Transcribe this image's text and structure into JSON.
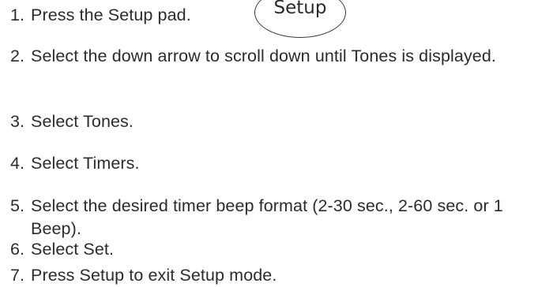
{
  "setup_pad": {
    "label": "Setup"
  },
  "steps": [
    {
      "number": "1.",
      "text": "Press the Setup pad."
    },
    {
      "number": "2.",
      "text": "Select the down arrow to scroll down until Tones is displayed."
    },
    {
      "number": "3.",
      "text": "Select Tones."
    },
    {
      "number": "4.",
      "text": "Select Timers."
    },
    {
      "number": "5.",
      "text": "Select the desired timer beep format (2-30 sec., 2-60 sec. or 1 Beep)."
    },
    {
      "number": "6.",
      "text": "Select Set."
    },
    {
      "number": "7.",
      "text": "Press Setup to exit Setup mode."
    }
  ]
}
